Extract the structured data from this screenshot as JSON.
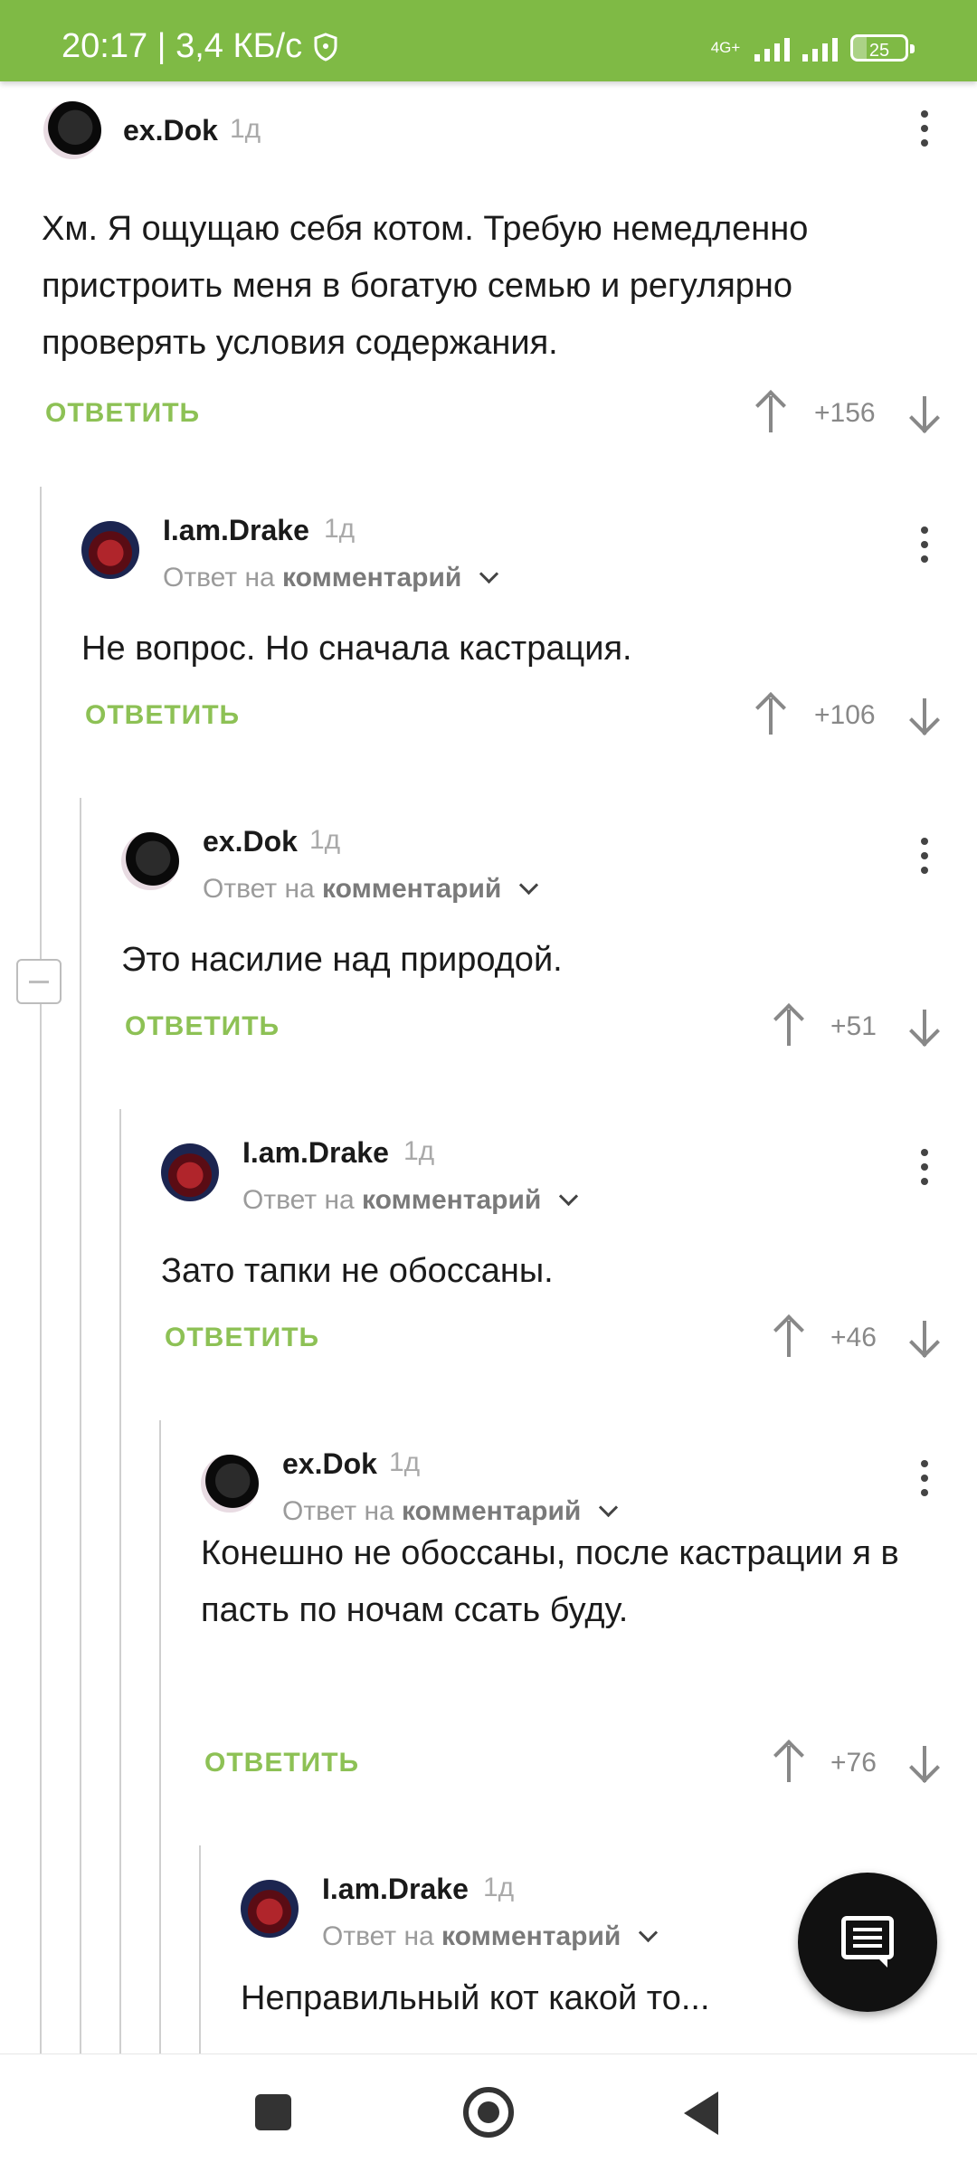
{
  "status_bar": {
    "time_speed": "20:17 | 3,4 КБ/с",
    "network": "4G+",
    "battery": "25",
    "battery_level_percent": 25
  },
  "comments": [
    {
      "username": "ex.Dok",
      "time": "1д",
      "reply_prefix": "",
      "reply_target": "",
      "text": "Хм. Я ощущаю себя котом. Требую немедленно пристроить меня в богатую семью и регулярно проверять условия содержания.",
      "reply_label": "ОТВЕТИТЬ",
      "score": "+156"
    },
    {
      "username": "I.am.Drake",
      "time": "1д",
      "reply_prefix": "Ответ на",
      "reply_target": "комментарий",
      "text": "Не вопрос. Но сначала кастрация.",
      "reply_label": "ОТВЕТИТЬ",
      "score": "+106"
    },
    {
      "username": "ex.Dok",
      "time": "1д",
      "reply_prefix": "Ответ на",
      "reply_target": "комментарий",
      "text": "Это насилие над природой.",
      "reply_label": "ОТВЕТИТЬ",
      "score": "+51"
    },
    {
      "username": "I.am.Drake",
      "time": "1д",
      "reply_prefix": "Ответ на",
      "reply_target": "комментарий",
      "text": "Зато тапки не обоссаны.",
      "reply_label": "ОТВЕТИТЬ",
      "score": "+46"
    },
    {
      "username": "ex.Dok",
      "time": "1д",
      "reply_prefix": "Ответ на",
      "reply_target": "комментарий",
      "text": "Конешно не обоссаны, после кастрации я в пасть по ночам ссать буду.",
      "reply_label": "ОТВЕТИТЬ",
      "score": "+76"
    },
    {
      "username": "I.am.Drake",
      "time": "1д",
      "reply_prefix": "Ответ на",
      "reply_target": "комментарий",
      "text": "Неправильный кот какой то...",
      "reply_label": "",
      "score": ""
    }
  ]
}
